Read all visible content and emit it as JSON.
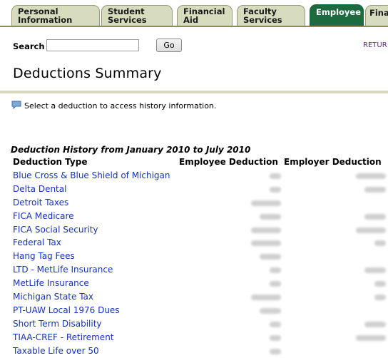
{
  "tabs": [
    {
      "lines": [
        "Personal",
        "Information"
      ]
    },
    {
      "lines": [
        "Student",
        "Services"
      ]
    },
    {
      "lines": [
        "Financial",
        "Aid"
      ]
    },
    {
      "lines": [
        "Faculty",
        "Services"
      ]
    },
    {
      "lines": [
        "Employee"
      ],
      "active": true
    },
    {
      "lines": [
        "Finan"
      ]
    }
  ],
  "search": {
    "label": "Search",
    "value": "",
    "go_label": "Go",
    "return_label": "RETUR"
  },
  "page_title": "Deductions Summary",
  "info_text": "Select a deduction to access history information.",
  "history": {
    "heading": "Deduction History from January 2010 to July 2010",
    "columns": [
      "Deduction Type",
      "Employee Deduction",
      "Employer Deduction"
    ],
    "rows": [
      {
        "type": "Blue Cross & Blue Shield of Michigan",
        "employee_blur": "short",
        "employer_blur": "long"
      },
      {
        "type": "Delta Dental",
        "employee_blur": "short",
        "employer_blur": "med"
      },
      {
        "type": "Detroit Taxes",
        "employee_blur": "long",
        "employer_blur": ""
      },
      {
        "type": "FICA Medicare",
        "employee_blur": "med",
        "employer_blur": "med"
      },
      {
        "type": "FICA Social Security",
        "employee_blur": "long",
        "employer_blur": "long"
      },
      {
        "type": "Federal Tax",
        "employee_blur": "long",
        "employer_blur": "short"
      },
      {
        "type": "Hang Tag Fees",
        "employee_blur": "med",
        "employer_blur": ""
      },
      {
        "type": "LTD - MetLife Insurance",
        "employee_blur": "short",
        "employer_blur": "med"
      },
      {
        "type": "MetLife Insurance",
        "employee_blur": "short",
        "employer_blur": "short"
      },
      {
        "type": "Michigan State Tax",
        "employee_blur": "long",
        "employer_blur": "short"
      },
      {
        "type": "PT-UAW Local 1976 Dues",
        "employee_blur": "med",
        "employer_blur": ""
      },
      {
        "type": "Short Term Disability",
        "employee_blur": "short",
        "employer_blur": "med"
      },
      {
        "type": "TIAA-CREF - Retirement",
        "employee_blur": "short",
        "employer_blur": "long"
      },
      {
        "type": "Taxable Life over 50",
        "employee_blur": "short",
        "employer_blur": ""
      }
    ]
  },
  "colors": {
    "link": "#1632c0",
    "tab_active": "#1b6b3e",
    "tab_inactive": "#d8dcbf",
    "rule": "#d6d9bd"
  }
}
